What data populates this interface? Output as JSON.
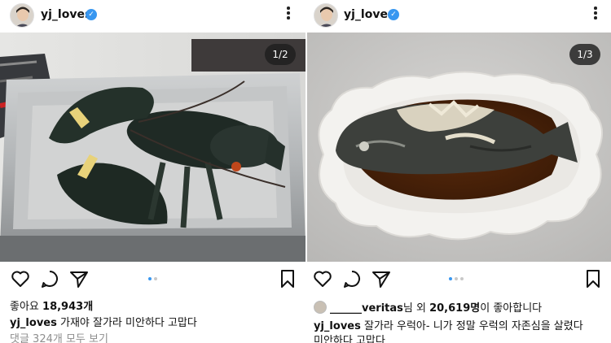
{
  "left_post": {
    "username": "yj_loves",
    "photo_counter": "1/2",
    "likes_prefix": "좋아요",
    "likes_count": "18,943개",
    "caption_user": "yj_loves",
    "caption_text": "가재야 잘가라 미안하다 고맙다",
    "view_comments": "댓글 324개 모두 보기",
    "carousel_dots": 2,
    "carousel_active": 0
  },
  "right_post": {
    "username": "yj_loves",
    "photo_counter": "1/3",
    "liked_by_user": "______veritas",
    "liked_by_suffix": "님 외",
    "likes_count": "20,619명",
    "likes_suffix": "이 좋아합니다",
    "caption_user": "yj_loves",
    "caption_line1": "잘가라 우럭아-  니가 정말 우럭의 자존심을 살렸다",
    "caption_line2": "미안하다 고맙다",
    "carousel_dots": 3,
    "carousel_active": 0
  },
  "icons": {
    "verified": "verified-badge-icon",
    "more": "more-options-icon",
    "like": "heart-icon",
    "comment": "comment-bubble-icon",
    "share": "paper-plane-icon",
    "save": "bookmark-icon"
  },
  "colors": {
    "verified": "#3897f0",
    "active_dot": "#3897f0",
    "muted_text": "#8e8e8e"
  }
}
